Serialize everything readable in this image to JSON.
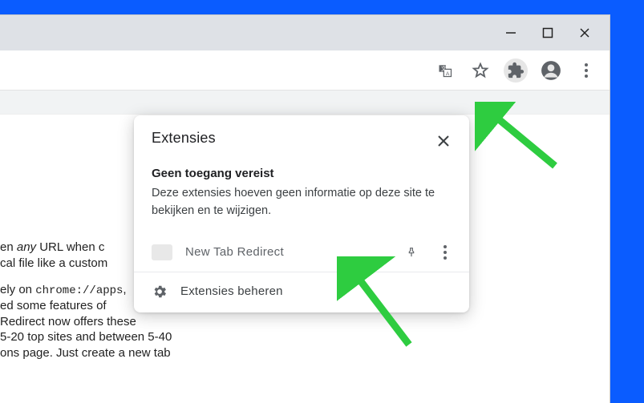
{
  "popup": {
    "title": "Extensies",
    "section_heading": "Geen toegang vereist",
    "section_desc": "Deze extensies hoeven geen informatie op deze site te bekijken en te wijzigen.",
    "extension_name": "New Tab Redirect",
    "manage_label": "Extensies beheren"
  },
  "page": {
    "line1_part1": "en ",
    "line1_any": "any",
    "line1_part2": " URL when c",
    "line2": "cal file like a custom",
    "line3_part1": "ely on ",
    "line3_code": "chrome://apps",
    "line4": "ed some features of",
    "line5": "Redirect now offers these",
    "line6": "5-20 top sites and between 5-40",
    "line7": "ons page. Just create a new tab"
  }
}
